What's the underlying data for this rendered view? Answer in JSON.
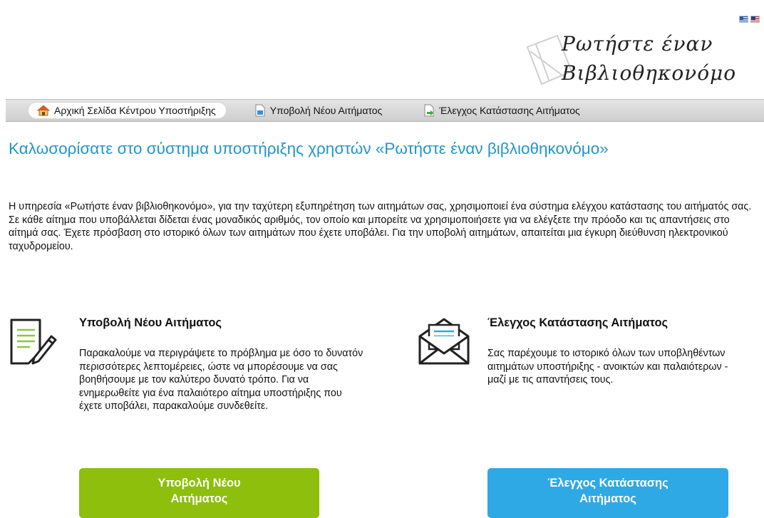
{
  "flags": [
    {
      "name": "greek-flag-icon"
    },
    {
      "name": "english-flag-icon"
    }
  ],
  "logo": {
    "line1": "Ρωτήστε έναν",
    "line2": "Βιβλιοθηκονόμο"
  },
  "nav": {
    "home": "Αρχική Σελίδα Κέντρου Υποστήριξης",
    "new_ticket": "Υποβολή Νέου Αιτήματος",
    "check_status": "Έλεγχος Κατάστασης Αιτήματος"
  },
  "welcome": {
    "title": "Καλωσορίσατε στο σύστημα υποστήριξης χρηστών «Ρωτήστε έναν βιβλιοθηκονόμο»",
    "intro": "Η υπηρεσία «Ρωτήστε έναν βιβλιοθηκονόμο», για την ταχύτερη εξυπηρέτηση των αιτημάτων σας, χρησιμοποιεί ένα σύστημα ελέγχου κατάστασης του αιτήματός σας. Σε κάθε αίτημα που υποβάλλεται δίδεται ένας μοναδικός αριθμός, τον οποίο και μπορείτε να χρησιμοποιήσετε για να ελέγξετε την πρόοδο και τις απαντήσεις στο αίτημά σας. Έχετε πρόσβαση στο ιστορικό όλων των αιτημάτων που έχετε υποβάλει. Για την υποβολή αιτημάτων, απαιτείται μια έγκυρη διεύθυνση ηλεκτρονικού ταχυδρομείου."
  },
  "new_ticket_panel": {
    "icon": "document-pencil-icon",
    "title": "Υποβολή Νέου Αιτήματος",
    "text": "Παρακαλούμε να περιγράψετε το πρόβλημα με όσο το δυνατόν περισσότερες λεπτομέρειες, ώστε να μπορέσουμε να σας βοηθήσουμε με τον καλύτερο δυνατό τρόπο. Για να ενημερωθείτε για ένα παλαιότερο αίτημα υποστήριξης που έχετε υποβάλει, παρακαλούμε συνδεθείτε.",
    "button_line1": "Υποβολή Νέου",
    "button_line2": "Αιτήματος",
    "button_color": "#8dbf0c"
  },
  "check_status_panel": {
    "icon": "open-envelope-icon",
    "title": "Έλεγχος Κατάστασης Αιτήματος",
    "text": "Σας παρέχουμε το ιστορικό όλων των υποβληθέντων αιτημάτων υποστήριξης - ανοικτών και παλαιότερων - μαζί με τις απαντήσεις τους.",
    "button_line1": "Έλεγχος Κατάστασης",
    "button_line2": "Αιτήματος",
    "button_color": "#2fa8e6"
  },
  "colors": {
    "heading_blue": "#2196c9",
    "nav_bg": "#d9d9d9"
  }
}
